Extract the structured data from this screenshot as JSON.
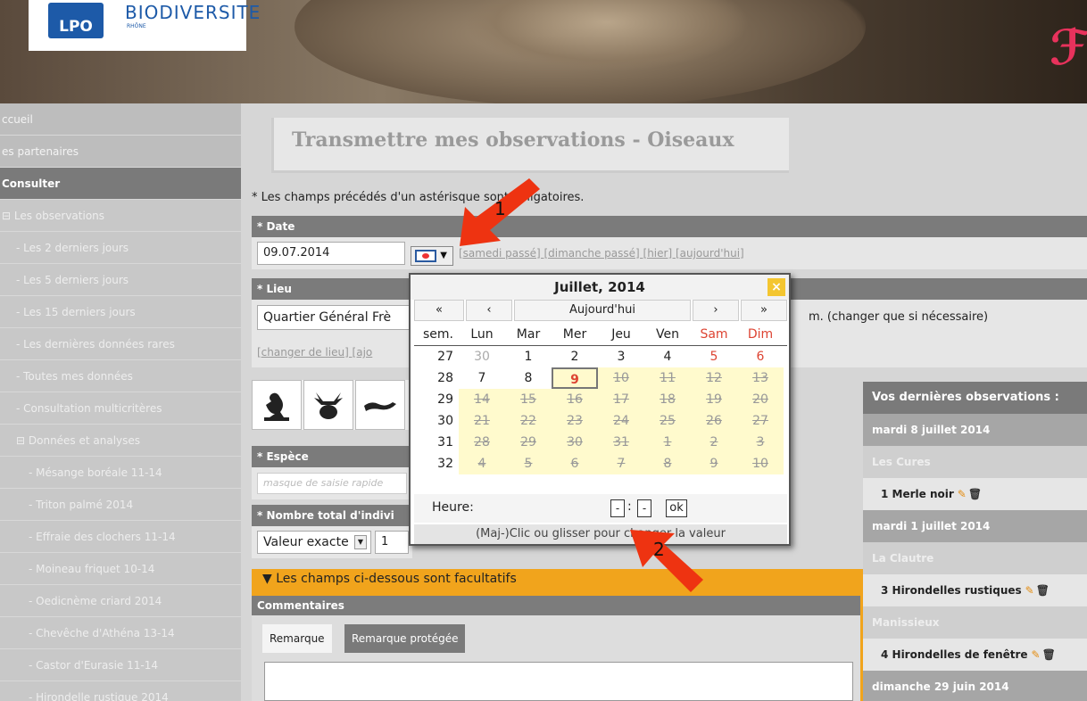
{
  "banner": {
    "logo_lpo": "LPO",
    "logo_title": "BIODIVERSITE",
    "logo_region": "RHÔNE",
    "brand_glyph": "ℱ"
  },
  "sidebar": {
    "items": [
      {
        "label": "ccueil",
        "kind": "hdr"
      },
      {
        "label": "es partenaires",
        "kind": "hdr"
      },
      {
        "label": "Consulter",
        "kind": "dark"
      },
      {
        "label": "Les observations",
        "kind": "plain",
        "prefix": "⊟ "
      },
      {
        "label": "- Les 2 derniers jours",
        "kind": "sub"
      },
      {
        "label": "- Les 5 derniers jours",
        "kind": "sub"
      },
      {
        "label": "- Les 15 derniers jours",
        "kind": "sub"
      },
      {
        "label": "- Les dernières données rares",
        "kind": "sub"
      },
      {
        "label": "- Toutes mes données",
        "kind": "sub"
      },
      {
        "label": "- Consultation multicritères",
        "kind": "sub"
      },
      {
        "label": "Données et analyses",
        "kind": "sub",
        "prefix": "⊟ "
      },
      {
        "label": "- Mésange boréale 11-14",
        "kind": "sub2"
      },
      {
        "label": "- Triton palmé 2014",
        "kind": "sub2"
      },
      {
        "label": "- Effraie des clochers 11-14",
        "kind": "sub2"
      },
      {
        "label": "- Moineau friquet 10-14",
        "kind": "sub2"
      },
      {
        "label": "- Oedicnème criard 2014",
        "kind": "sub2"
      },
      {
        "label": "- Chevêche d'Athéna 13-14",
        "kind": "sub2"
      },
      {
        "label": "- Castor d'Eurasie 11-14",
        "kind": "sub2"
      },
      {
        "label": "- Hirondelle rustique 2014",
        "kind": "sub2"
      }
    ]
  },
  "main": {
    "title": "Transmettre mes observations - Oiseaux",
    "required_note": "* Les champs précédés d'un astérisque sont obligatoires.",
    "date_label": "* Date",
    "date_value": "09.07.2014",
    "date_links": "[samedi passé] [dimanche passé] [hier] [aujourd'hui]",
    "lieu_label": "* Lieu",
    "lieu_value": "Quartier Général Frè",
    "lieu_suffix": "m. (changer que si nécessaire)",
    "lieu_links": "[changer de lieu] [ajo",
    "espece_label": "* Espèce",
    "espece_placeholder": "masque de saisie rapide",
    "nombre_label": "* Nombre total d'indivi",
    "valeur_select": "Valeur exacte",
    "valeur_count": "1",
    "optional_header": "Les champs ci-dessous sont facultatifs",
    "commentaires_label": "Commentaires",
    "tab_remarque": "Remarque",
    "tab_remarque_protegee": "Remarque protégée"
  },
  "right_panel": {
    "title": "Vos dernières observations :",
    "rows": [
      {
        "kind": "date",
        "text": "mardi 8 juillet 2014"
      },
      {
        "kind": "loc",
        "text": "Les Cures"
      },
      {
        "kind": "obs",
        "text": "1 Merle noir"
      },
      {
        "kind": "date",
        "text": "mardi 1 juillet 2014"
      },
      {
        "kind": "loc",
        "text": "La Clautre"
      },
      {
        "kind": "obs",
        "text": "3 Hirondelles rustiques"
      },
      {
        "kind": "loc",
        "text": "Manissieux"
      },
      {
        "kind": "obs",
        "text": "4 Hirondelles de fenêtre"
      },
      {
        "kind": "date",
        "text": "dimanche 29 juin 2014"
      }
    ]
  },
  "calendar": {
    "title": "Juillet, 2014",
    "close": "×",
    "nav_prev_year": "«",
    "nav_prev_month": "‹",
    "nav_today": "Aujourd'hui",
    "nav_next_month": "›",
    "nav_next_year": "»",
    "headers": [
      "sem.",
      "Lun",
      "Mar",
      "Mer",
      "Jeu",
      "Ven",
      "Sam",
      "Dim"
    ],
    "weeks": [
      {
        "wk": "27",
        "days": [
          "30",
          "1",
          "2",
          "3",
          "4",
          "5",
          "6"
        ],
        "states": [
          "other",
          "past",
          "past",
          "past",
          "past",
          "weekend",
          "weekend"
        ]
      },
      {
        "wk": "28",
        "days": [
          "7",
          "8",
          "9",
          "10",
          "11",
          "12",
          "13"
        ],
        "states": [
          "past",
          "past",
          "today",
          "future",
          "future",
          "future",
          "future"
        ]
      },
      {
        "wk": "29",
        "days": [
          "14",
          "15",
          "16",
          "17",
          "18",
          "19",
          "20"
        ],
        "states": [
          "future",
          "future",
          "future",
          "future",
          "future",
          "future",
          "future"
        ]
      },
      {
        "wk": "30",
        "days": [
          "21",
          "22",
          "23",
          "24",
          "25",
          "26",
          "27"
        ],
        "states": [
          "future",
          "future",
          "future",
          "future",
          "future",
          "future",
          "future"
        ]
      },
      {
        "wk": "31",
        "days": [
          "28",
          "29",
          "30",
          "31",
          "1",
          "2",
          "3"
        ],
        "states": [
          "future",
          "future",
          "future",
          "future",
          "future",
          "future",
          "future"
        ]
      },
      {
        "wk": "32",
        "days": [
          "4",
          "5",
          "6",
          "7",
          "8",
          "9",
          "10"
        ],
        "states": [
          "future",
          "future",
          "future",
          "future",
          "future",
          "future",
          "future"
        ]
      }
    ],
    "heure_label": "Heure:",
    "hour_value": "-",
    "minute_value": "-",
    "time_sep": ":",
    "ok_label": "ok",
    "footer": "(Maj-)Clic ou glisser pour changer la valeur"
  },
  "annotations": {
    "arrow1": "1",
    "arrow2": "2"
  },
  "colors": {
    "accent_orange": "#f1a41c",
    "weekend_red": "#d43",
    "future_yellow": "#fffacd",
    "arrow_red": "#e31"
  }
}
